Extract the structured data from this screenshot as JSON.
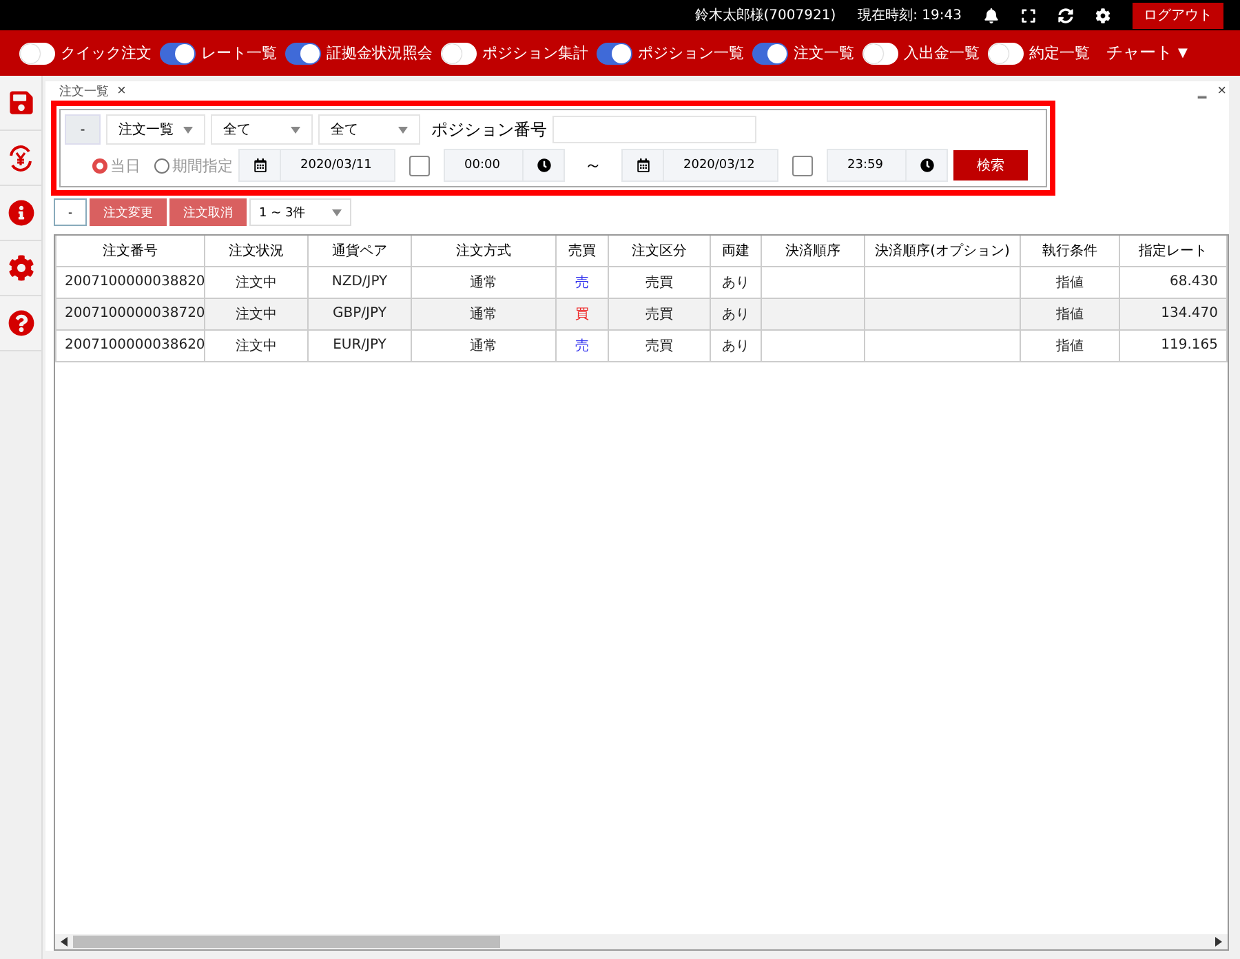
{
  "header": {
    "user": "鈴木太郎様(7007921)",
    "clock": "現在時刻: 19:43",
    "logout": "ログアウト"
  },
  "nav": [
    {
      "label": "クイック注文",
      "on": false
    },
    {
      "label": "レート一覧",
      "on": true
    },
    {
      "label": "証拠金状況照会",
      "on": true
    },
    {
      "label": "ポジション集計",
      "on": false
    },
    {
      "label": "ポジション一覧",
      "on": true
    },
    {
      "label": "注文一覧",
      "on": true
    },
    {
      "label": "入出金一覧",
      "on": false
    },
    {
      "label": "約定一覧",
      "on": false
    }
  ],
  "chart_menu": {
    "label": "チャート",
    "caret": "▼"
  },
  "panel": {
    "title": "注文一覧",
    "close": "×",
    "minimize": "‗"
  },
  "filter": {
    "collapse": "-",
    "selects": [
      "注文一覧",
      "全て",
      "全て"
    ],
    "position_label": "ポジション番号",
    "radios": [
      {
        "label": "当日",
        "selected": true
      },
      {
        "label": "期間指定",
        "selected": false
      }
    ],
    "from_date": "2020/03/11",
    "from_time_enabled": false,
    "from_time": "00:00",
    "tilde": "～",
    "to_date": "2020/03/12",
    "to_time_enabled": false,
    "to_time": "23:59",
    "search": "検索"
  },
  "toolbar": {
    "collapse": "-",
    "buttons": [
      "注文変更",
      "注文取消"
    ],
    "count": "1 ~ 3件"
  },
  "table": {
    "columns": [
      "注文番号",
      "注文状況",
      "通貨ペア",
      "注文方式",
      "売買",
      "注文区分",
      "両建",
      "決済順序",
      "決済順序(オプション)",
      "執行条件",
      "指定レート"
    ],
    "rows": [
      {
        "cells": [
          "2007100000038820",
          "注文中",
          "NZD/JPY",
          "通常",
          "売",
          "売買",
          "あり",
          "",
          "",
          "指値",
          "68.430"
        ],
        "color": "#3333ee"
      },
      {
        "cells": [
          "2007100000038720",
          "注文中",
          "GBP/JPY",
          "通常",
          "買",
          "売買",
          "あり",
          "",
          "",
          "指値",
          "134.470"
        ],
        "color": "#ee2222"
      },
      {
        "cells": [
          "2007100000038620",
          "注文中",
          "EUR/JPY",
          "通常",
          "売",
          "売買",
          "あり",
          "",
          "",
          "指値",
          "119.165"
        ],
        "color": "#3333ee"
      }
    ]
  }
}
